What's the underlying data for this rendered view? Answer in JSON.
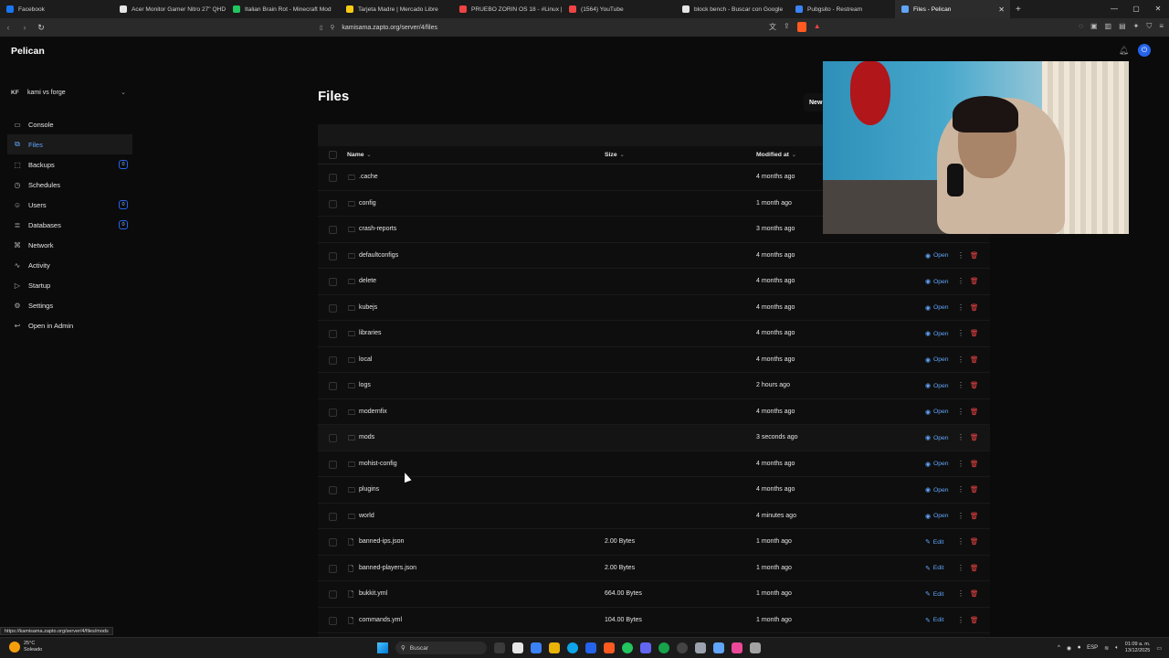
{
  "browser": {
    "tabs": [
      {
        "label": "Facebook",
        "color": "#1877f2"
      },
      {
        "label": "Acer Monitor Gamer Nitro 27\" QHD",
        "color": "#e5e5e5"
      },
      {
        "label": "Italian Brain Rot - Minecraft Mod",
        "color": "#22c55e"
      },
      {
        "label": "Tarjeta Madre | Mercado Libre",
        "color": "#facc15"
      },
      {
        "label": "PRUEBO ZORIN OS 18 - #Linux |",
        "color": "#ef4444"
      },
      {
        "label": "(1564) YouTube",
        "color": "#ef4444"
      },
      {
        "label": "block bench - Buscar con Google",
        "color": "#e5e5e5"
      },
      {
        "label": "Pubgsito - Restream",
        "color": "#3b82f6"
      },
      {
        "label": "Files - Pelican",
        "color": "#60a5fa"
      }
    ],
    "url": "kamisama.zapto.org/server/4/files",
    "status_url": "https://kamisama.zapto.org/server/4/files/mods"
  },
  "app": {
    "brand": "Pelican",
    "server_initials": "KF",
    "server_name": "kami vs forge",
    "nav": [
      {
        "label": "Console",
        "icon": "console-icon",
        "glyph": "▭"
      },
      {
        "label": "Files",
        "icon": "files-icon",
        "glyph": "⧉",
        "active": true
      },
      {
        "label": "Backups",
        "icon": "backups-icon",
        "glyph": "⬚",
        "badge": "0"
      },
      {
        "label": "Schedules",
        "icon": "clock-icon",
        "glyph": "◷"
      },
      {
        "label": "Users",
        "icon": "users-icon",
        "glyph": "☺",
        "badge": "0"
      },
      {
        "label": "Databases",
        "icon": "database-icon",
        "glyph": "≣",
        "badge": "0"
      },
      {
        "label": "Network",
        "icon": "network-icon",
        "glyph": "⌘"
      },
      {
        "label": "Activity",
        "icon": "activity-icon",
        "glyph": "∿"
      },
      {
        "label": "Startup",
        "icon": "play-icon",
        "glyph": "▷"
      },
      {
        "label": "Settings",
        "icon": "gear-icon",
        "glyph": "⚙"
      },
      {
        "label": "Open in Admin",
        "icon": "return-icon",
        "glyph": "↩"
      }
    ],
    "page_title": "Files",
    "new_button": "New",
    "columns": {
      "name": "Name",
      "size": "Size",
      "modified": "Modified at"
    },
    "files": [
      {
        "name": ".cache",
        "type": "folder",
        "size": "",
        "modified": "4 months ago",
        "action": ""
      },
      {
        "name": "config",
        "type": "folder",
        "size": "",
        "modified": "1 month ago",
        "action": ""
      },
      {
        "name": "crash-reports",
        "type": "folder",
        "size": "",
        "modified": "3 months ago",
        "action": "Open"
      },
      {
        "name": "defaultconfigs",
        "type": "folder",
        "size": "",
        "modified": "4 months ago",
        "action": "Open"
      },
      {
        "name": "delete",
        "type": "folder",
        "size": "",
        "modified": "4 months ago",
        "action": "Open"
      },
      {
        "name": "kubejs",
        "type": "folder",
        "size": "",
        "modified": "4 months ago",
        "action": "Open"
      },
      {
        "name": "libraries",
        "type": "folder",
        "size": "",
        "modified": "4 months ago",
        "action": "Open"
      },
      {
        "name": "local",
        "type": "folder",
        "size": "",
        "modified": "4 months ago",
        "action": "Open"
      },
      {
        "name": "logs",
        "type": "folder",
        "size": "",
        "modified": "2 hours ago",
        "action": "Open"
      },
      {
        "name": "modernfix",
        "type": "folder",
        "size": "",
        "modified": "4 months ago",
        "action": "Open"
      },
      {
        "name": "mods",
        "type": "folder",
        "size": "",
        "modified": "3 seconds ago",
        "action": "Open"
      },
      {
        "name": "mohist-config",
        "type": "folder",
        "size": "",
        "modified": "4 months ago",
        "action": "Open"
      },
      {
        "name": "plugins",
        "type": "folder",
        "size": "",
        "modified": "4 months ago",
        "action": "Open"
      },
      {
        "name": "world",
        "type": "folder",
        "size": "",
        "modified": "4 minutes ago",
        "action": "Open"
      },
      {
        "name": "banned-ips.json",
        "type": "file",
        "size": "2.00 Bytes",
        "modified": "1 month ago",
        "action": "Edit"
      },
      {
        "name": "banned-players.json",
        "type": "file",
        "size": "2.00 Bytes",
        "modified": "1 month ago",
        "action": "Edit"
      },
      {
        "name": "bukkit.yml",
        "type": "file",
        "size": "664.00 Bytes",
        "modified": "1 month ago",
        "action": "Edit"
      },
      {
        "name": "commands.yml",
        "type": "file",
        "size": "104.00 Bytes",
        "modified": "1 month ago",
        "action": "Edit"
      }
    ]
  },
  "taskbar": {
    "weather_temp": "25°C",
    "weather_text": "Soleado",
    "search_placeholder": "Buscar",
    "lang": "ESP",
    "time": "01:09 a. m.",
    "date": "13/12/2025"
  }
}
